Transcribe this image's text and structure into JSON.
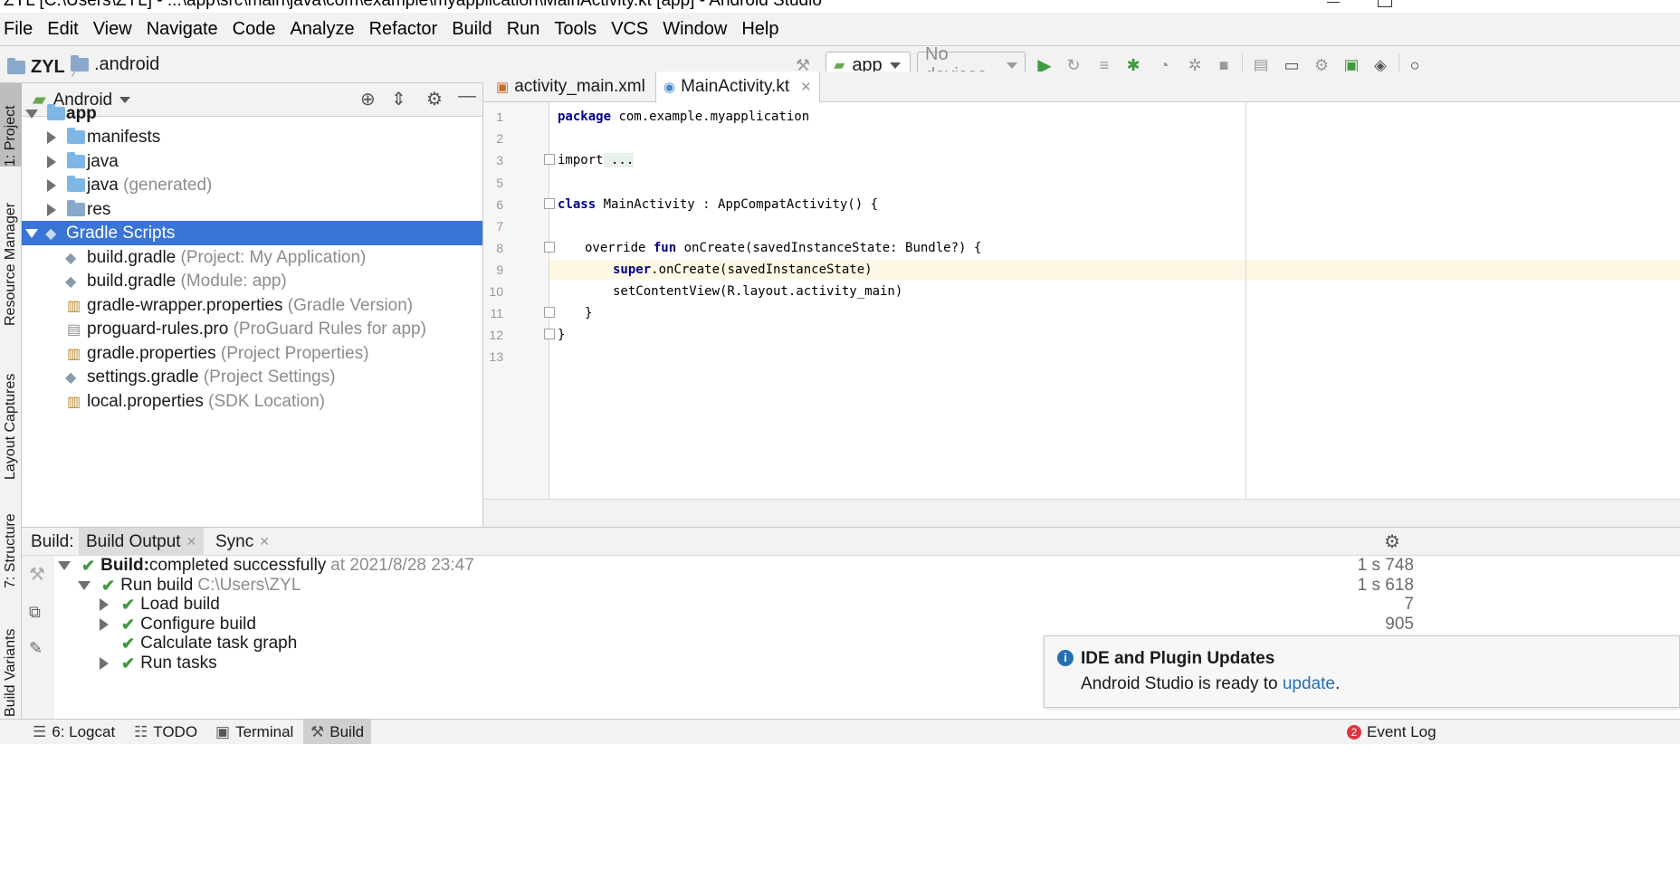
{
  "window": {
    "title": "ZYL [C:\\Users\\ZYL] - ...\\app\\src\\main\\java\\com\\example\\myapplication\\MainActivity.kt [app] - Android Studio"
  },
  "menu": [
    "File",
    "Edit",
    "View",
    "Navigate",
    "Code",
    "Analyze",
    "Refactor",
    "Build",
    "Run",
    "Tools",
    "VCS",
    "Window",
    "Help"
  ],
  "breadcrumb": {
    "project": "ZYL",
    "folder": ".android"
  },
  "toolbar": {
    "run_config": "app",
    "device": "No devices"
  },
  "left_stripe": {
    "project_tab": "1: Project",
    "resource_manager_tab": "Resource Manager",
    "layout_captures_tab": "Layout Captures",
    "structure_tab": "7: Structure",
    "build_variants_tab": "Build Variants"
  },
  "project_panel": {
    "view_mode": "Android",
    "tree": [
      {
        "name": "app",
        "hint": ""
      },
      {
        "name": "manifests",
        "hint": ""
      },
      {
        "name": "java",
        "hint": ""
      },
      {
        "name": "java",
        "hint": "(generated)"
      },
      {
        "name": "res",
        "hint": ""
      },
      {
        "name": "Gradle Scripts",
        "hint": ""
      },
      {
        "name": "build.gradle",
        "hint": "(Project: My Application)"
      },
      {
        "name": "build.gradle",
        "hint": "(Module: app)"
      },
      {
        "name": "gradle-wrapper.properties",
        "hint": "(Gradle Version)"
      },
      {
        "name": "proguard-rules.pro",
        "hint": "(ProGuard Rules for app)"
      },
      {
        "name": "gradle.properties",
        "hint": "(Project Properties)"
      },
      {
        "name": "settings.gradle",
        "hint": "(Project Settings)"
      },
      {
        "name": "local.properties",
        "hint": "(SDK Location)"
      }
    ]
  },
  "editor": {
    "tabs": [
      {
        "label": "activity_main.xml"
      },
      {
        "label": "MainActivity.kt"
      }
    ],
    "line_numbers": [
      "1",
      "2",
      "3",
      "5",
      "6",
      "7",
      "8",
      "9",
      "10",
      "11",
      "12",
      "13"
    ],
    "code": {
      "l1_kw": "package",
      "l1_rest": " com.example.myapplication",
      "l3_import": "import",
      "l3_dots": " ...",
      "l6_kw": "class",
      "l6_rest": " MainActivity : AppCompatActivity() {",
      "l8_override": "override",
      "l8_fun": " fun",
      "l8_rest": " onCreate(savedInstanceState: Bundle?) {",
      "l9_super": "super",
      "l9_rest": ".onCreate(savedInstanceState)",
      "l10": "setContentView(R.layout.activity_main)",
      "l11": "}",
      "l12": "}"
    }
  },
  "build_panel": {
    "label": "Build:",
    "tabs": [
      {
        "label": "Build Output"
      },
      {
        "label": "Sync"
      }
    ],
    "root": {
      "bold": "Build:",
      "text": " completed successfully",
      "when": "at 2021/8/28 23:47",
      "time": "1 s 748"
    },
    "run_build": {
      "text": "Run build",
      "path": "C:\\Users\\ZYL",
      "time": "1 s 618"
    },
    "steps": [
      {
        "label": "Load build",
        "time": "7"
      },
      {
        "label": "Configure build",
        "time": "905"
      },
      {
        "label": "Calculate task graph",
        "time": ""
      },
      {
        "label": "Run tasks",
        "time": ""
      }
    ]
  },
  "notification": {
    "title": "IDE and Plugin Updates",
    "text": "Android Studio is ready to ",
    "link": "update",
    "end": "."
  },
  "bottom_bar": {
    "logcat": "6: Logcat",
    "todo": "TODO",
    "terminal": "Terminal",
    "build": "Build",
    "event_log": "Event Log",
    "event_count": "2"
  },
  "colors": {
    "selection": "#3875d7",
    "keyword": "#00008b",
    "success": "#3f9b3f",
    "link": "#2470b3"
  }
}
